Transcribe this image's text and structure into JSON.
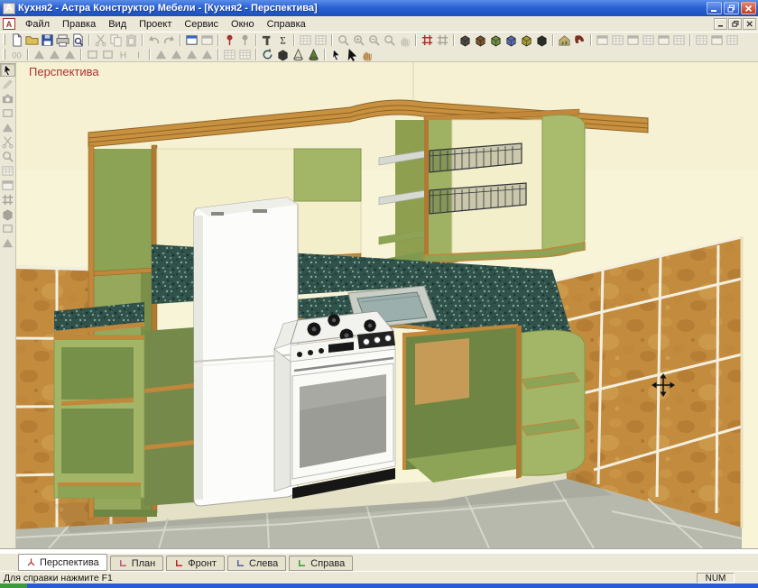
{
  "window": {
    "title": "Кухня2 - Астра Конструктор Мебели - [Кухня2 - Перспектива]",
    "controls": [
      "minimize",
      "maximize",
      "close"
    ]
  },
  "menu": {
    "items": [
      {
        "key": "file",
        "label": "Файл"
      },
      {
        "key": "edit",
        "label": "Правка"
      },
      {
        "key": "view",
        "label": "Вид"
      },
      {
        "key": "project",
        "label": "Проект"
      },
      {
        "key": "service",
        "label": "Сервис"
      },
      {
        "key": "window",
        "label": "Окно"
      },
      {
        "key": "help",
        "label": "Справка"
      }
    ],
    "child_controls": [
      "child-minimize",
      "child-restore",
      "child-close"
    ]
  },
  "toolbars": {
    "row1": [
      {
        "name": "new-document",
        "icon": "page",
        "enabled": true
      },
      {
        "name": "open-project",
        "icon": "folder",
        "enabled": true
      },
      {
        "name": "save-project",
        "icon": "floppy",
        "enabled": true
      },
      {
        "name": "print",
        "icon": "printer",
        "enabled": true
      },
      {
        "name": "print-preview",
        "icon": "preview",
        "enabled": true
      },
      "|",
      {
        "name": "cut",
        "icon": "cut",
        "enabled": false
      },
      {
        "name": "copy",
        "icon": "copy",
        "enabled": false
      },
      {
        "name": "paste",
        "icon": "paste",
        "enabled": false
      },
      "|",
      {
        "name": "undo",
        "icon": "undo",
        "enabled": false
      },
      {
        "name": "redo",
        "icon": "redo",
        "enabled": false
      },
      "|",
      {
        "name": "project-window",
        "icon": "window",
        "enabled": true
      },
      {
        "name": "project-window-alt",
        "icon": "window",
        "enabled": false
      },
      "|",
      {
        "name": "pin-marker",
        "icon": "pin",
        "enabled": true,
        "color": "#B03030"
      },
      {
        "name": "pin-marker-alt",
        "icon": "pin",
        "enabled": false
      },
      "|",
      {
        "name": "tools",
        "icon": "hammer",
        "enabled": true
      },
      {
        "name": "calc-sum",
        "icon": "sigma",
        "enabled": true
      },
      "|",
      {
        "name": "spec-table-1",
        "icon": "table",
        "enabled": false
      },
      {
        "name": "spec-table-2",
        "icon": "table",
        "enabled": false
      },
      "|",
      {
        "name": "zoom-window",
        "icon": "mag",
        "enabled": false
      },
      {
        "name": "zoom-in",
        "icon": "magplus",
        "enabled": false
      },
      {
        "name": "zoom-out",
        "icon": "magminus",
        "enabled": false
      },
      {
        "name": "zoom-extents",
        "icon": "mag",
        "enabled": false
      },
      {
        "name": "pan-view",
        "icon": "hand",
        "enabled": false
      },
      "|",
      {
        "name": "snap-grid",
        "icon": "grid",
        "enabled": true,
        "color": "#B03030"
      },
      {
        "name": "grid-settings",
        "icon": "grid",
        "enabled": false
      },
      "|",
      {
        "name": "view-material-dark",
        "icon": "cube",
        "enabled": true,
        "color": "#4A4A40"
      },
      {
        "name": "view-material-brown",
        "icon": "cube",
        "enabled": true,
        "color": "#7A5228"
      },
      {
        "name": "view-material-green",
        "icon": "cube",
        "enabled": true,
        "color": "#6E8E3A"
      },
      {
        "name": "view-material-blue",
        "icon": "cube",
        "enabled": true,
        "color": "#5868B4"
      },
      {
        "name": "view-material-olive",
        "icon": "cube",
        "enabled": true,
        "color": "#A89C2C"
      },
      {
        "name": "view-material-black",
        "icon": "cube",
        "enabled": true,
        "color": "#2E2E28"
      },
      "|",
      {
        "name": "room-materials",
        "icon": "house",
        "enabled": true
      },
      {
        "name": "order-contact",
        "icon": "phone",
        "enabled": true,
        "color": "#7A3020"
      },
      "|",
      {
        "name": "report-window-1",
        "icon": "window",
        "enabled": false
      },
      {
        "name": "report-window-2",
        "icon": "table",
        "enabled": false
      },
      {
        "name": "report-window-3",
        "icon": "window",
        "enabled": false
      },
      {
        "name": "report-window-4",
        "icon": "table",
        "enabled": false
      },
      {
        "name": "report-window-5",
        "icon": "window",
        "enabled": false
      },
      {
        "name": "report-window-6",
        "icon": "table",
        "enabled": false
      },
      "|",
      {
        "name": "export-1",
        "icon": "table",
        "enabled": false
      },
      {
        "name": "export-2",
        "icon": "window",
        "enabled": false
      },
      {
        "name": "export-3",
        "icon": "table",
        "enabled": false
      }
    ],
    "row2": [
      {
        "name": "coords-00",
        "icon": "d00",
        "enabled": false
      },
      "|",
      {
        "name": "align-top",
        "icon": "tri",
        "enabled": false
      },
      {
        "name": "align-middle",
        "icon": "tri",
        "enabled": false
      },
      {
        "name": "align-bottom",
        "icon": "tri",
        "enabled": false
      },
      "|",
      {
        "name": "distribute-h",
        "icon": "rectsh",
        "enabled": false
      },
      {
        "name": "distribute-v",
        "icon": "rectsh",
        "enabled": false
      },
      {
        "name": "size-height",
        "icon": "th",
        "enabled": false
      },
      {
        "name": "size-width",
        "icon": "ti",
        "enabled": false
      },
      "|",
      {
        "name": "nudge-down",
        "icon": "tri",
        "enabled": false
      },
      {
        "name": "nudge-up",
        "icon": "tri",
        "enabled": false
      },
      {
        "name": "nudge-right",
        "icon": "tri",
        "enabled": false
      },
      {
        "name": "nudge-left",
        "icon": "tri",
        "enabled": false
      },
      "|",
      {
        "name": "layout-grid-a",
        "icon": "table",
        "enabled": false
      },
      {
        "name": "layout-grid-b",
        "icon": "table",
        "enabled": false
      },
      "|",
      {
        "name": "orbit-view",
        "icon": "rotate",
        "enabled": true
      },
      {
        "name": "display-solid",
        "icon": "cube",
        "enabled": true,
        "color": "#3A3A34"
      },
      {
        "name": "display-wireframe",
        "icon": "cone",
        "enabled": true,
        "color": "#E2DEC8"
      },
      {
        "name": "display-shaded",
        "icon": "cone",
        "enabled": true,
        "color": "#5E7E30"
      },
      "|",
      {
        "name": "select-object",
        "icon": "cursor",
        "enabled": true
      },
      {
        "name": "select-add",
        "icon": "pointer",
        "enabled": true
      },
      {
        "name": "page-move",
        "icon": "hand",
        "enabled": true
      }
    ],
    "left": [
      {
        "name": "select-cursor",
        "icon": "cursor",
        "enabled": true,
        "pressed": true
      },
      {
        "name": "draw-line",
        "icon": "pencil",
        "enabled": false
      },
      {
        "name": "camera-view",
        "icon": "camera",
        "enabled": false,
        "color": "#A03030"
      },
      {
        "name": "draw-rect",
        "icon": "rectsh",
        "enabled": false
      },
      {
        "name": "draw-poly",
        "icon": "tri",
        "enabled": false
      },
      {
        "name": "erase",
        "icon": "cut",
        "enabled": false
      },
      {
        "name": "measure",
        "icon": "mag",
        "enabled": false
      },
      {
        "name": "panel-a",
        "icon": "table",
        "enabled": false
      },
      {
        "name": "panel-b",
        "icon": "window",
        "enabled": false
      },
      {
        "name": "panel-c",
        "icon": "grid",
        "enabled": false
      },
      {
        "name": "panel-d",
        "icon": "cube",
        "enabled": false
      },
      {
        "name": "panel-e",
        "icon": "rectsh",
        "enabled": false
      },
      {
        "name": "panel-f",
        "icon": "tri",
        "enabled": false
      }
    ]
  },
  "viewport": {
    "view_label": "Перспектива",
    "label_color": "#b03232",
    "cursor": "move-crosshair",
    "scene_objects": [
      "crown-molding",
      "upper-shelving-left",
      "upper-shelving-middle",
      "corner-shelves",
      "wire-basket-upper",
      "wire-basket-lower",
      "granite-backsplash",
      "granite-countertop",
      "corner-sink",
      "refrigerator",
      "gas-stove",
      "base-cabinet-left",
      "base-cabinet-corner",
      "quarter-round-shelves",
      "tiled-wall-left",
      "tiled-wall-right",
      "tiled-floor"
    ],
    "palette": {
      "wall": "#f8f4d8",
      "tile": "#c28b3e",
      "grout": "#f3efdf",
      "floor": "#b6b9ac",
      "cabinet_green": "#a3b566",
      "cabinet_green_dark": "#76904a",
      "wood_trim": "#c1873b",
      "granite": "#31524a",
      "fridge": "#fbfbf8",
      "stove": "#f4f4f0"
    }
  },
  "tabs": {
    "items": [
      {
        "key": "perspective",
        "label": "Перспектива",
        "icon": "axis",
        "icon_color": "#b03232",
        "active": true
      },
      {
        "key": "plan",
        "label": "План",
        "icon": "corner",
        "icon_color": "#c05878",
        "active": false
      },
      {
        "key": "front",
        "label": "Фронт",
        "icon": "corner",
        "icon_color": "#c02222",
        "active": false
      },
      {
        "key": "left",
        "label": "Слева",
        "icon": "corner",
        "icon_color": "#5560A8",
        "active": false
      },
      {
        "key": "right",
        "label": "Справа",
        "icon": "corner",
        "icon_color": "#3A9A3A",
        "active": false
      }
    ]
  },
  "statusbar": {
    "help_text": "Для справки нажмите F1",
    "num_indicator": "NUM"
  },
  "app_icon_letter": "А"
}
